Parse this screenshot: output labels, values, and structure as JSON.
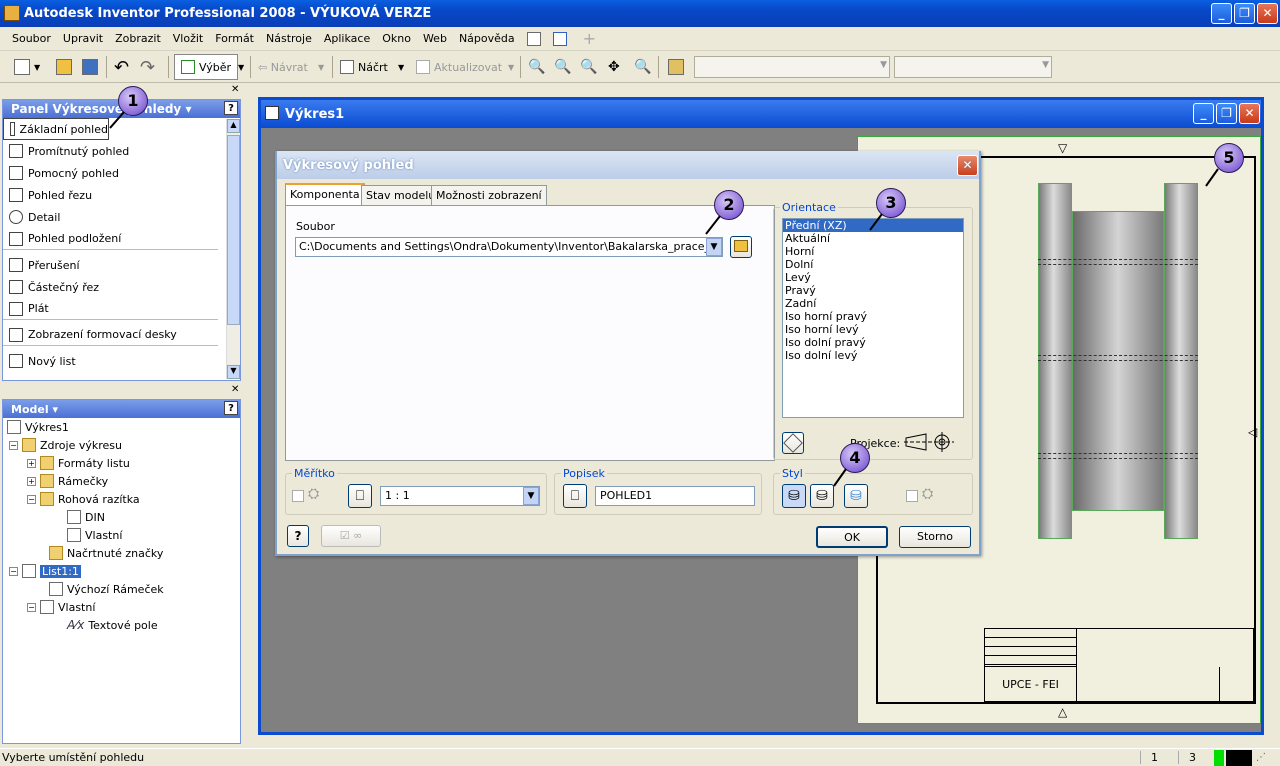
{
  "window": {
    "title": "Autodesk Inventor Professional 2008 - VÝUKOVÁ VERZE"
  },
  "menu": [
    "Soubor",
    "Upravit",
    "Zobrazit",
    "Vložit",
    "Formát",
    "Nástroje",
    "Aplikace",
    "Okno",
    "Web",
    "Nápověda"
  ],
  "toolbar": {
    "select_label": "Výběr",
    "back_label": "Návrat",
    "sketch_label": "Náčrt",
    "update_label": "Aktualizovat"
  },
  "panel": {
    "title": "Panel Výkresové pohledy",
    "items": [
      "Základní pohled",
      "Promítnutý pohled",
      "Pomocný pohled",
      "Pohled řezu",
      "Detail",
      "Pohled podložení",
      "Přerušení",
      "Částečný řez",
      "Plát",
      "Zobrazení formovací desky",
      "Nový list"
    ]
  },
  "model": {
    "title": "Model",
    "tree": [
      "Výkres1",
      "Zdroje výkresu",
      "Formáty listu",
      "Rámečky",
      "Rohová razítka",
      "DIN",
      "Vlastní",
      "Načrtnuté značky",
      "List1:1",
      "Výchozí Rámeček",
      "Vlastní",
      "Textové pole"
    ]
  },
  "mdi": {
    "title": "Výkres1"
  },
  "dialog": {
    "title": "Výkresový pohled",
    "tabs": [
      "Komponenta",
      "Stav modelu",
      "Možnosti zobrazení"
    ],
    "file_label": "Soubor",
    "file_path": "C:\\Documents and Settings\\Ondra\\Dokumenty\\Inventor\\Bakalarska_prace_kolo\\Ses",
    "orientation_label": "Orientace",
    "orientations": [
      "Přední (XZ)",
      "Aktuální",
      "Horní",
      "Dolní",
      "Levý",
      "Pravý",
      "Zadní",
      "Iso horní pravý",
      "Iso horní levý",
      "Iso dolní pravý",
      "Iso dolní levý"
    ],
    "projection_label": "Projekce:",
    "scale_label": "Měřítko",
    "scale_value": "1 : 1",
    "caption_label": "Popisek",
    "caption_value": "POHLED1",
    "style_label": "Styl",
    "ok": "OK",
    "cancel": "Storno"
  },
  "sheet": {
    "titleblock": "UPCE - FEI"
  },
  "badges": [
    "1",
    "2",
    "3",
    "4",
    "5"
  ],
  "status": {
    "text": "Vyberte umístění pohledu",
    "v1": "1",
    "v2": "3"
  }
}
